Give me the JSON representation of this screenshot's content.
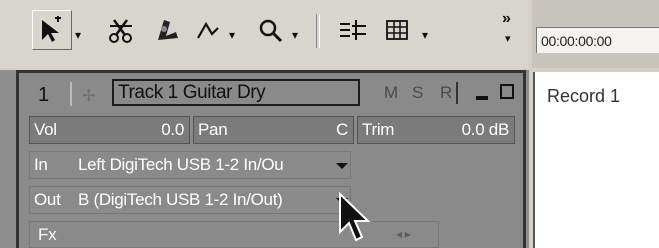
{
  "toolbar": {
    "tools": [
      {
        "icon": "smart-tool-icon",
        "has_dropdown": true
      },
      {
        "icon": "scissors-icon",
        "has_dropdown": false
      },
      {
        "icon": "erase-tool-icon",
        "has_dropdown": false
      },
      {
        "icon": "envelope-tool-icon",
        "has_dropdown": true
      },
      {
        "icon": "zoom-icon",
        "has_dropdown": true
      },
      {
        "icon": "snap-icon",
        "has_dropdown": false
      },
      {
        "icon": "grid-icon",
        "has_dropdown": true
      }
    ],
    "overflow_label": "»"
  },
  "time_display": {
    "value": "00:00:00:00"
  },
  "track": {
    "number": "1",
    "name": "Track 1 Guitar Dry",
    "mute_label": "M",
    "solo_label": "S",
    "record_label": "R",
    "vol_label": "Vol",
    "vol_value": "0.0",
    "pan_label": "Pan",
    "pan_value": "C",
    "trim_label": "Trim",
    "trim_value": "0.0 dB",
    "in_label": "In",
    "in_value": "Left DigiTech USB 1-2 In/Ou",
    "out_label": "Out",
    "out_value": "B (DigiTech USB 1-2 In/Out)",
    "fx_label": "Fx"
  },
  "clips_panel": {
    "clip_label": "Record 1"
  },
  "colors": {
    "toolbar_bg": "#d8d5cd",
    "strip_bg": "#8a8a8a",
    "row_bg": "#7b7b7b",
    "panel_bg": "#ffffff"
  }
}
